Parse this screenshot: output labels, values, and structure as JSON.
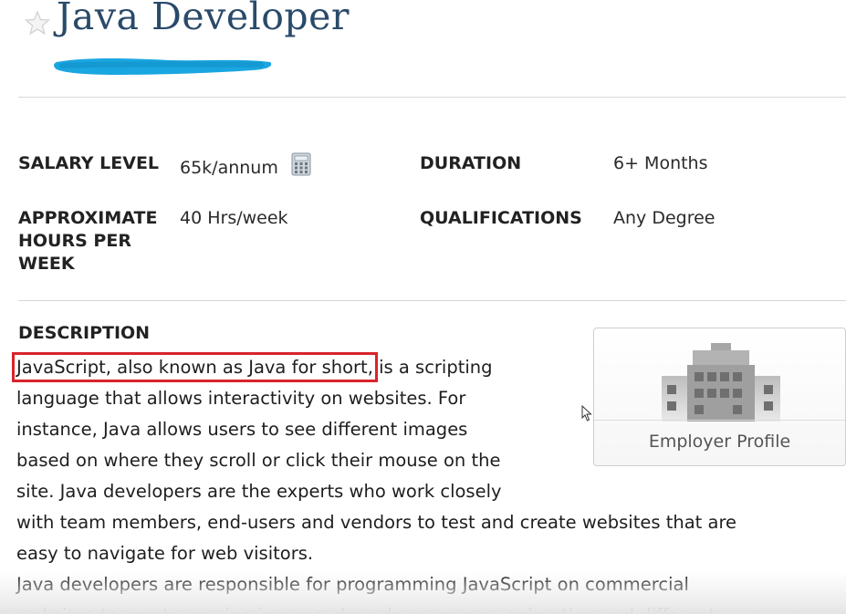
{
  "header": {
    "title": "Java Developer",
    "favorite_icon": "star-outline-icon"
  },
  "details": {
    "salary_label": "SALARY LEVEL",
    "salary_value": "65k/annum",
    "salary_icon": "calculator-icon",
    "duration_label": "DURATION",
    "duration_value": "6+ Months",
    "hours_label": "APPROXIMATE HOURS PER WEEK",
    "hours_value": "40 Hrs/week",
    "qualifications_label": "QUALIFICATIONS",
    "qualifications_value": "Any Degree"
  },
  "description": {
    "heading": "DESCRIPTION",
    "highlighted_phrase": "JavaScript, also known as Java for short,",
    "lines": [
      " is a scripting",
      "language that allows interactivity on websites. For",
      "instance, Java allows users to see different images",
      "based on where they scroll or click their mouse on the",
      "site. Java developers are the experts who work closely",
      "with team members, end-users and vendors to test and create websites that are",
      "easy to navigate for web visitors.",
      "Java developers are responsible for programming JavaScript on commercial",
      "websites to create moving images, drop-down menus, animation and different"
    ]
  },
  "employer_card": {
    "label": "Employer Profile",
    "icon": "building-icon"
  },
  "colors": {
    "title": "#2a4a6a",
    "highlight_border": "#d8242b",
    "redaction": "#1aa6e0"
  }
}
